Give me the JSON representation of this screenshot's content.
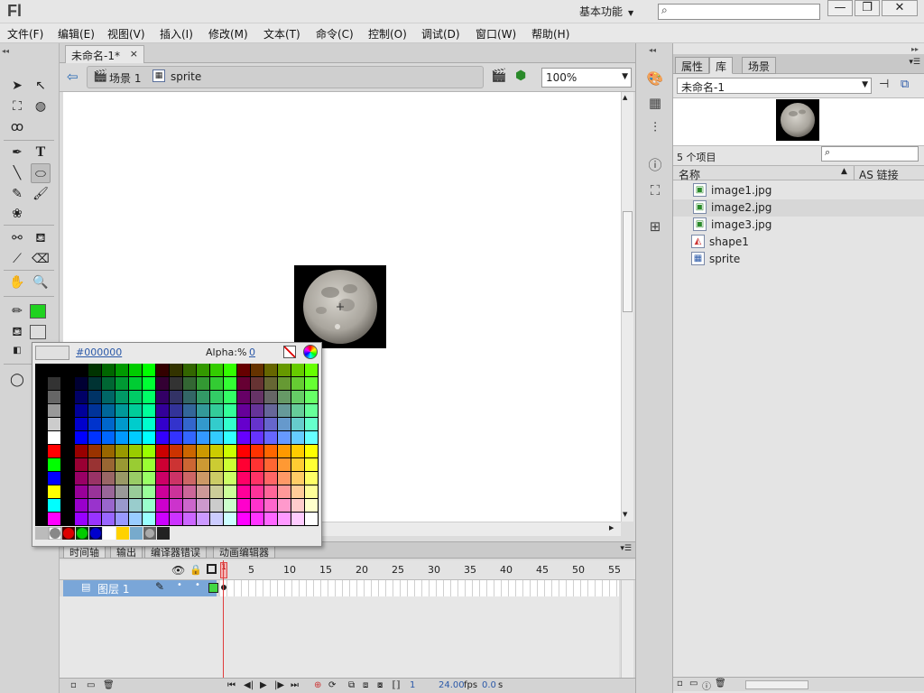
{
  "app": {
    "logo": "Fl",
    "workspace": "基本功能",
    "search_placeholder": ""
  },
  "menu": [
    "文件(F)",
    "编辑(E)",
    "视图(V)",
    "插入(I)",
    "修改(M)",
    "文本(T)",
    "命令(C)",
    "控制(O)",
    "调试(D)",
    "窗口(W)",
    "帮助(H)"
  ],
  "document": {
    "tab_title": "未命名-1*",
    "close": "×"
  },
  "editbar": {
    "scene": "场景 1",
    "symbol": "sprite",
    "zoom": "100%"
  },
  "swatches": {
    "hex": "#000000",
    "alpha_label": "Alpha:%",
    "alpha_value": "0"
  },
  "timeline": {
    "tabs": [
      "时间轴",
      "输出",
      "编译器错误",
      "动画编辑器"
    ],
    "frame_numbers": [
      "1",
      "5",
      "10",
      "15",
      "20",
      "25",
      "30",
      "35",
      "40",
      "45",
      "50",
      "55"
    ],
    "layer_name": "图层 1",
    "current_frame": "1",
    "fps": "24.00",
    "fps_unit": "fps",
    "time": "0.0",
    "time_unit": "s"
  },
  "library": {
    "tabs": [
      "属性",
      "库",
      "场景"
    ],
    "active_tab": "库",
    "document": "未命名-1",
    "count": "5 个项目",
    "col_name": "名称",
    "col_link": "AS 链接",
    "items": [
      {
        "name": "image1.jpg",
        "type": "bitmap"
      },
      {
        "name": "image2.jpg",
        "type": "bitmap"
      },
      {
        "name": "image3.jpg",
        "type": "bitmap"
      },
      {
        "name": "shape1",
        "type": "graphic"
      },
      {
        "name": "sprite",
        "type": "movieclip"
      }
    ]
  },
  "colors": {
    "fill": "#1fd21f",
    "playhead": "#e03c3c",
    "layer_selected": "#7aa6d8"
  }
}
